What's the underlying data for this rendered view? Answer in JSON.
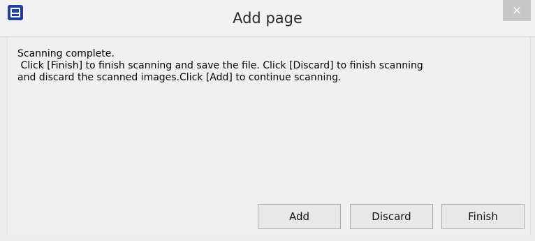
{
  "window": {
    "title": "Add page",
    "close_glyph": "×",
    "app_icon": "scanner-app-icon"
  },
  "message": {
    "line1": "Scanning complete.",
    "line2": " Click [Finish] to finish scanning and save the file. Click [Discard] to finish scanning",
    "line3": "and discard the scanned images.Click [Add] to continue scanning."
  },
  "buttons": {
    "add": "Add",
    "discard": "Discard",
    "finish": "Finish"
  },
  "colors": {
    "icon_blue": "#1e3fa8",
    "close_bg": "#c7c7c7"
  }
}
